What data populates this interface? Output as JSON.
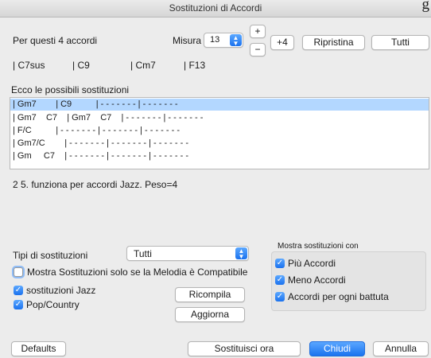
{
  "window": {
    "title": "Sostituzioni di Accordi",
    "corner_glyph": "g"
  },
  "header": {
    "per_label": "Per questi 4 accordi",
    "measure_label": "Misura",
    "measure_value": "13",
    "plus_label": "+",
    "minus_label": "−",
    "plus4_label": "+4",
    "ripristina_label": "Ripristina",
    "tutti_label": "Tutti"
  },
  "chords": [
    "| C7sus",
    "| C9",
    "| Cm7",
    "| F13"
  ],
  "list": {
    "title": "Ecco le possibili sostituzioni",
    "rows": [
      "| Gm7        | C9          | - - - - - - - | - - - - - - -",
      "| Gm7    C7    | Gm7    C7    | - - - - - - - | - - - - - - -",
      "| F/C          | - - - - - - - | - - - - - - - | - - - - - - -",
      "| Gm7/C        | - - - - - - - | - - - - - - - | - - - - - - -",
      "| Gm     C7    | - - - - - - - | - - - - - - - | - - - - - - -"
    ],
    "selected_index": 0
  },
  "description": "2 5.  funziona per accordi Jazz. Peso=4",
  "types": {
    "label": "Tipi di sostituzioni",
    "selected": "Tutti"
  },
  "checks": {
    "melody": {
      "label": "Mostra Sostituzioni solo se la Melodia è Compatibile",
      "checked": false
    },
    "jazz": {
      "label": "sostituzioni Jazz",
      "checked": true
    },
    "pop": {
      "label": "Pop/Country",
      "checked": true
    }
  },
  "ricompila_label": "Ricompila",
  "aggiorna_label": "Aggiorna",
  "show_group": {
    "title": "Mostra sostituzioni con",
    "items": [
      {
        "label": "Più Accordi",
        "checked": true
      },
      {
        "label": "Meno Accordi",
        "checked": true
      },
      {
        "label": "Accordi per ogni battuta",
        "checked": true
      }
    ]
  },
  "footer": {
    "defaults_label": "Defaults",
    "sostituisci_label": "Sostituisci ora",
    "chiudi_label": "Chiudi",
    "annulla_label": "Annulla"
  },
  "colors": {
    "accent": "#1b72ee",
    "selection": "#b3d7ff"
  }
}
